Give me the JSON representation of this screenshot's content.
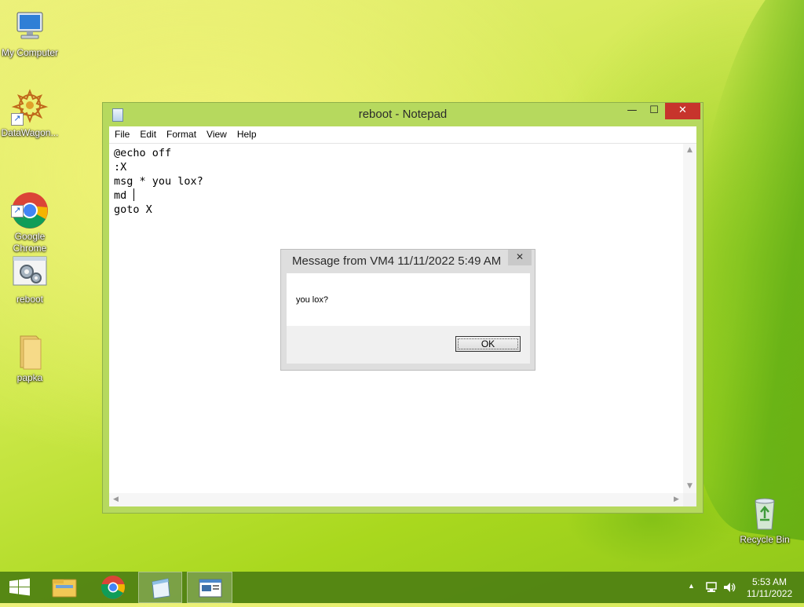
{
  "desktop": {
    "icons": [
      {
        "label": "My Computer",
        "icon": "computer-icon"
      },
      {
        "label": "DataWagon...",
        "icon": "datawagon-icon"
      },
      {
        "label": "Google\nChrome",
        "icon": "chrome-icon"
      },
      {
        "label": "reboot",
        "icon": "batch-file-icon"
      },
      {
        "label": "papka",
        "icon": "folder-icon"
      },
      {
        "label": "Recycle Bin",
        "icon": "recycle-bin-icon"
      }
    ]
  },
  "notepad": {
    "title": "reboot - Notepad",
    "menu": [
      "File",
      "Edit",
      "Format",
      "View",
      "Help"
    ],
    "lines": [
      "@echo off",
      ":X",
      "msg * you lox?",
      "md ",
      "goto X"
    ]
  },
  "message_box": {
    "title": "Message from VM4 11/11/2022 5:49 AM",
    "text": "you lox?",
    "ok_label": "OK"
  },
  "taskbar": {
    "items": [
      "start-icon",
      "file-explorer-icon",
      "chrome-icon",
      "notepad-icon",
      "message-window-icon"
    ],
    "clock_time": "5:53 AM",
    "clock_date": "11/11/2022"
  },
  "colors": {
    "close_button": "#c7342c",
    "taskbar": "#4e8012",
    "window_frame": "#b6d95e"
  }
}
